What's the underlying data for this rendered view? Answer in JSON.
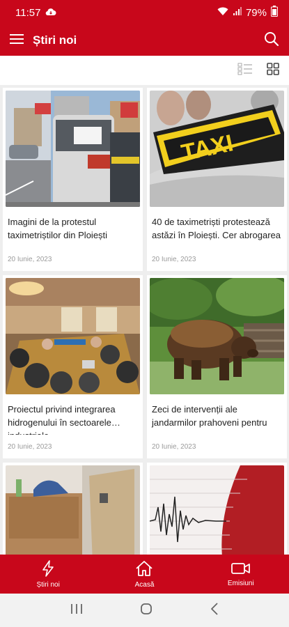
{
  "status": {
    "time": "11:57",
    "battery": "79%"
  },
  "header": {
    "title": "Știri noi"
  },
  "articles": [
    {
      "headline": "Imagini de la protestul taximetriștilor din Ploiești",
      "date": "20 Iunie, 2023"
    },
    {
      "headline": "40 de taximetriști protestează astăzi în Ploiești. Cer abrogarea",
      "date": "20 Iunie, 2023"
    },
    {
      "headline": "Proiectul privind integrarea hidrogenului în sectoarele industriale",
      "date": "20 Iunie, 2023"
    },
    {
      "headline": "Zeci de intervenții ale jandarmilor prahoveni pentru",
      "date": "20 Iunie, 2023"
    },
    {
      "headline": "",
      "date": ""
    },
    {
      "headline": "",
      "date": ""
    }
  ],
  "nav": {
    "news": "Știri noi",
    "home": "Acasă",
    "shows": "Emisiuni"
  },
  "colors": {
    "brand": "#c8071b"
  }
}
